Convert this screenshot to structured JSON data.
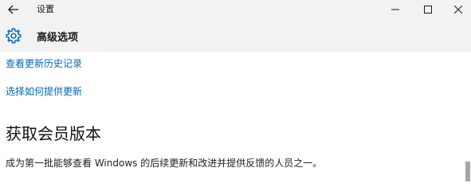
{
  "window": {
    "title": "设置"
  },
  "header": {
    "title": "高级选项"
  },
  "content": {
    "link_history": "查看更新历史记录",
    "link_how": "选择如何提供更新",
    "section_title": "获取会员版本",
    "description": "成为第一批能够查看 Windows 的后续更新和改进并提供反馈的人员之一。"
  },
  "colors": {
    "link": "#0067b8",
    "titlebar_bg": "#f2f2f2",
    "accent_icon": "#0067b8"
  },
  "icons": {
    "back": "back-arrow-icon",
    "minimize": "minimize-icon",
    "maximize": "maximize-icon",
    "close": "close-icon",
    "settings": "gear-icon"
  }
}
